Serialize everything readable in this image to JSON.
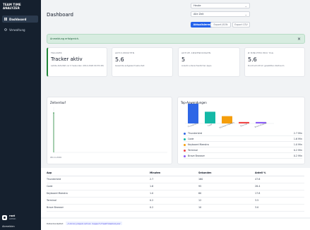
{
  "sidebar": {
    "brand_line1": "TEAM TIME",
    "brand_line2": "ANALYZER",
    "items": [
      {
        "label": "Dashboard",
        "icon": "dashboard-icon"
      },
      {
        "label": "Verwaltung",
        "icon": "settings-icon"
      }
    ],
    "user": {
      "name": "root",
      "role": "admin"
    },
    "logout_label": "Abmelden"
  },
  "header": {
    "title": "Dashboard",
    "select_user": "Heute",
    "select_range": "Alle Zeit",
    "refresh_label": "Aktualisieren",
    "export_json_label": "Export JSON",
    "export_csv_label": "Export CSV"
  },
  "alert": {
    "text": "Anmeldung erfolgreich.",
    "close": "×"
  },
  "kpis": [
    {
      "label": "TRACKER",
      "value": "Tracker aktiv",
      "sub": "Letzte Aktivität vor 0 Sekunden (08.4.2026 09:35:48)"
    },
    {
      "label": "AKTIV-MINUTEN",
      "value": "5.6",
      "sub": "Gesamte aufgezeichnete Zeit"
    },
    {
      "label": "AKTIVE ANWENDUNGEN",
      "value": "5",
      "sub": "Anzahl unterschiedlicher Apps"
    },
    {
      "label": "Ø MINUTEN PRO TAG",
      "value": "5.6",
      "sub": "Durchschnitt im gewählten Zeitraum"
    }
  ],
  "timeline": {
    "title": "Zeitverlauf",
    "x_label": "08.11.2026"
  },
  "top_apps": {
    "title": "Top-Anwendungen"
  },
  "chart_data": {
    "type": "bar",
    "title": "Top-Anwendungen",
    "categories": [
      "Thunderbird",
      "Code",
      "Keyboard Maestro",
      "Terminal",
      "Brave Browser"
    ],
    "values": [
      2.7,
      1.6,
      1.0,
      0.2,
      0.2
    ],
    "unit": "Min",
    "colors": [
      "#2e66e6",
      "#14b8a6",
      "#f59e0b",
      "#ef4444",
      "#8b5cf6"
    ]
  },
  "table": {
    "headers": [
      "App",
      "Minuten",
      "Sekunden",
      "Anteil %"
    ],
    "rows": [
      [
        "Thunderbird",
        "2.7",
        "160",
        "47.6"
      ],
      [
        "Code",
        "1.6",
        "95",
        "28.4"
      ],
      [
        "Keyboard Maestro",
        "1.0",
        "60",
        "17.8"
      ],
      [
        "Terminal",
        "0.2",
        "12",
        "3.5"
      ],
      [
        "Brave Browser",
        "0.2",
        "10",
        "3.0"
      ]
    ]
  },
  "db_path": {
    "label": "Datenbankpfad:",
    "value": "/Library/Application Support/TeamTimeAnalyzer"
  }
}
